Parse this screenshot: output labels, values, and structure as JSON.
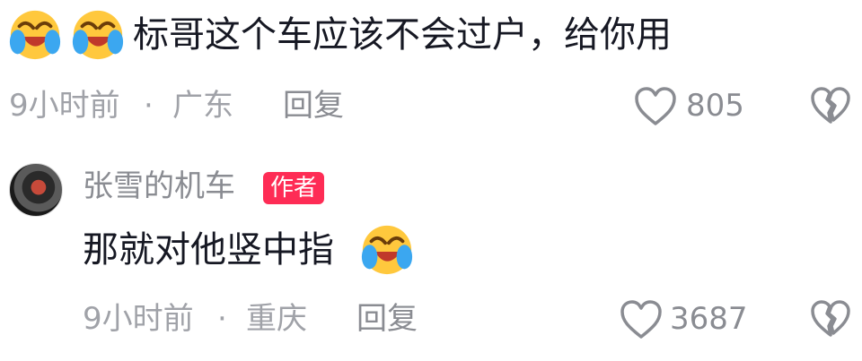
{
  "comments": [
    {
      "text": "标哥这个车应该不会过户，给你用",
      "leading_emojis": [
        "crying-laughing-face",
        "crying-laughing-face"
      ],
      "time": "9小时前",
      "separator": "·",
      "location": "广东",
      "reply_label": "回复",
      "like_count": "805"
    },
    {
      "username": "张雪的机车",
      "badge": "作者",
      "text": "那就对他竖中指",
      "trailing_emoji": "crying-laughing-face",
      "time": "9小时前",
      "separator": "·",
      "location": "重庆",
      "reply_label": "回复",
      "like_count": "3687"
    }
  ],
  "colors": {
    "badge": "#fe2c55",
    "text": "#161823",
    "meta": "#a0a2a8"
  }
}
